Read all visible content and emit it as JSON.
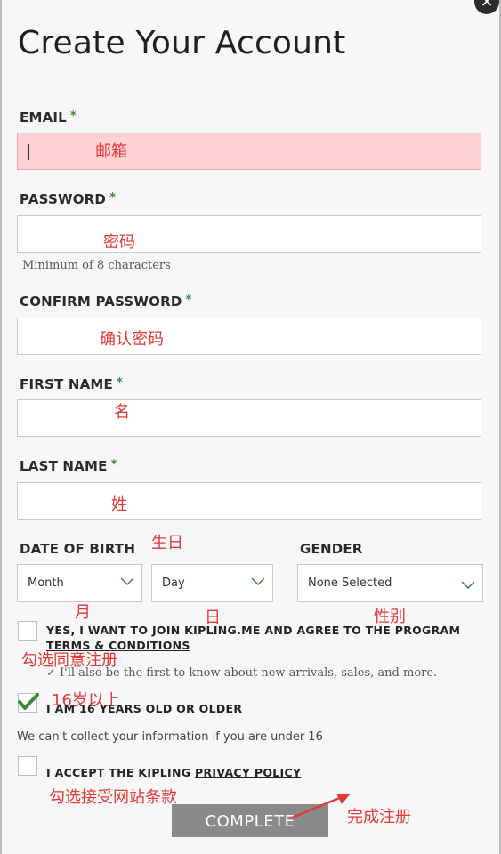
{
  "modal": {
    "title": "Create Your Account",
    "close_label": "×"
  },
  "form": {
    "email": {
      "label": "EMAIL",
      "required": "*",
      "value": ""
    },
    "password": {
      "label": "PASSWORD",
      "required": "*",
      "value": "",
      "hint": "Minimum of 8 characters"
    },
    "confirm_password": {
      "label": "CONFIRM PASSWORD",
      "required": "*",
      "value": ""
    },
    "first_name": {
      "label": "FIRST NAME",
      "required": "*",
      "value": ""
    },
    "last_name": {
      "label": "LAST NAME",
      "required": "*",
      "value": ""
    },
    "dob": {
      "label": "DATE OF BIRTH",
      "month": "Month",
      "day": "Day"
    },
    "gender": {
      "label": "GENDER",
      "value": "None Selected"
    },
    "program_checkbox": {
      "checked": false,
      "text": "YES, I WANT TO JOIN KIPLING.ME AND AGREE TO THE PROGRAM",
      "link": "TERMS & CONDITIONS",
      "subtext": "✓ I'll also be the first to know about new arrivals, sales, and more."
    },
    "age_checkbox": {
      "checked": true,
      "text": "I AM 16 YEARS OLD OR OLDER",
      "subtext": "We can't collect your information if you are under 16"
    },
    "privacy_checkbox": {
      "checked": false,
      "text": "I ACCEPT THE KIPLING",
      "link": "PRIVACY POLICY"
    },
    "submit_label": "COMPLETE"
  },
  "annotations": {
    "email": "邮箱",
    "password": "密码",
    "confirm_password": "确认密码",
    "first_name": "名",
    "last_name": "姓",
    "birthday": "生日",
    "month": "月",
    "day": "日",
    "gender": "性别",
    "agree_program": "勾选同意注册",
    "age": "16岁以上",
    "accept_terms": "勾选接受网站条款",
    "complete": "完成注册"
  },
  "colors": {
    "active_field": "#ffd0d4",
    "annotation": "#e23a3a",
    "required_star": "#3a8a3a",
    "checkmark": "#3a8a3a",
    "button": "#8a8a8a"
  }
}
